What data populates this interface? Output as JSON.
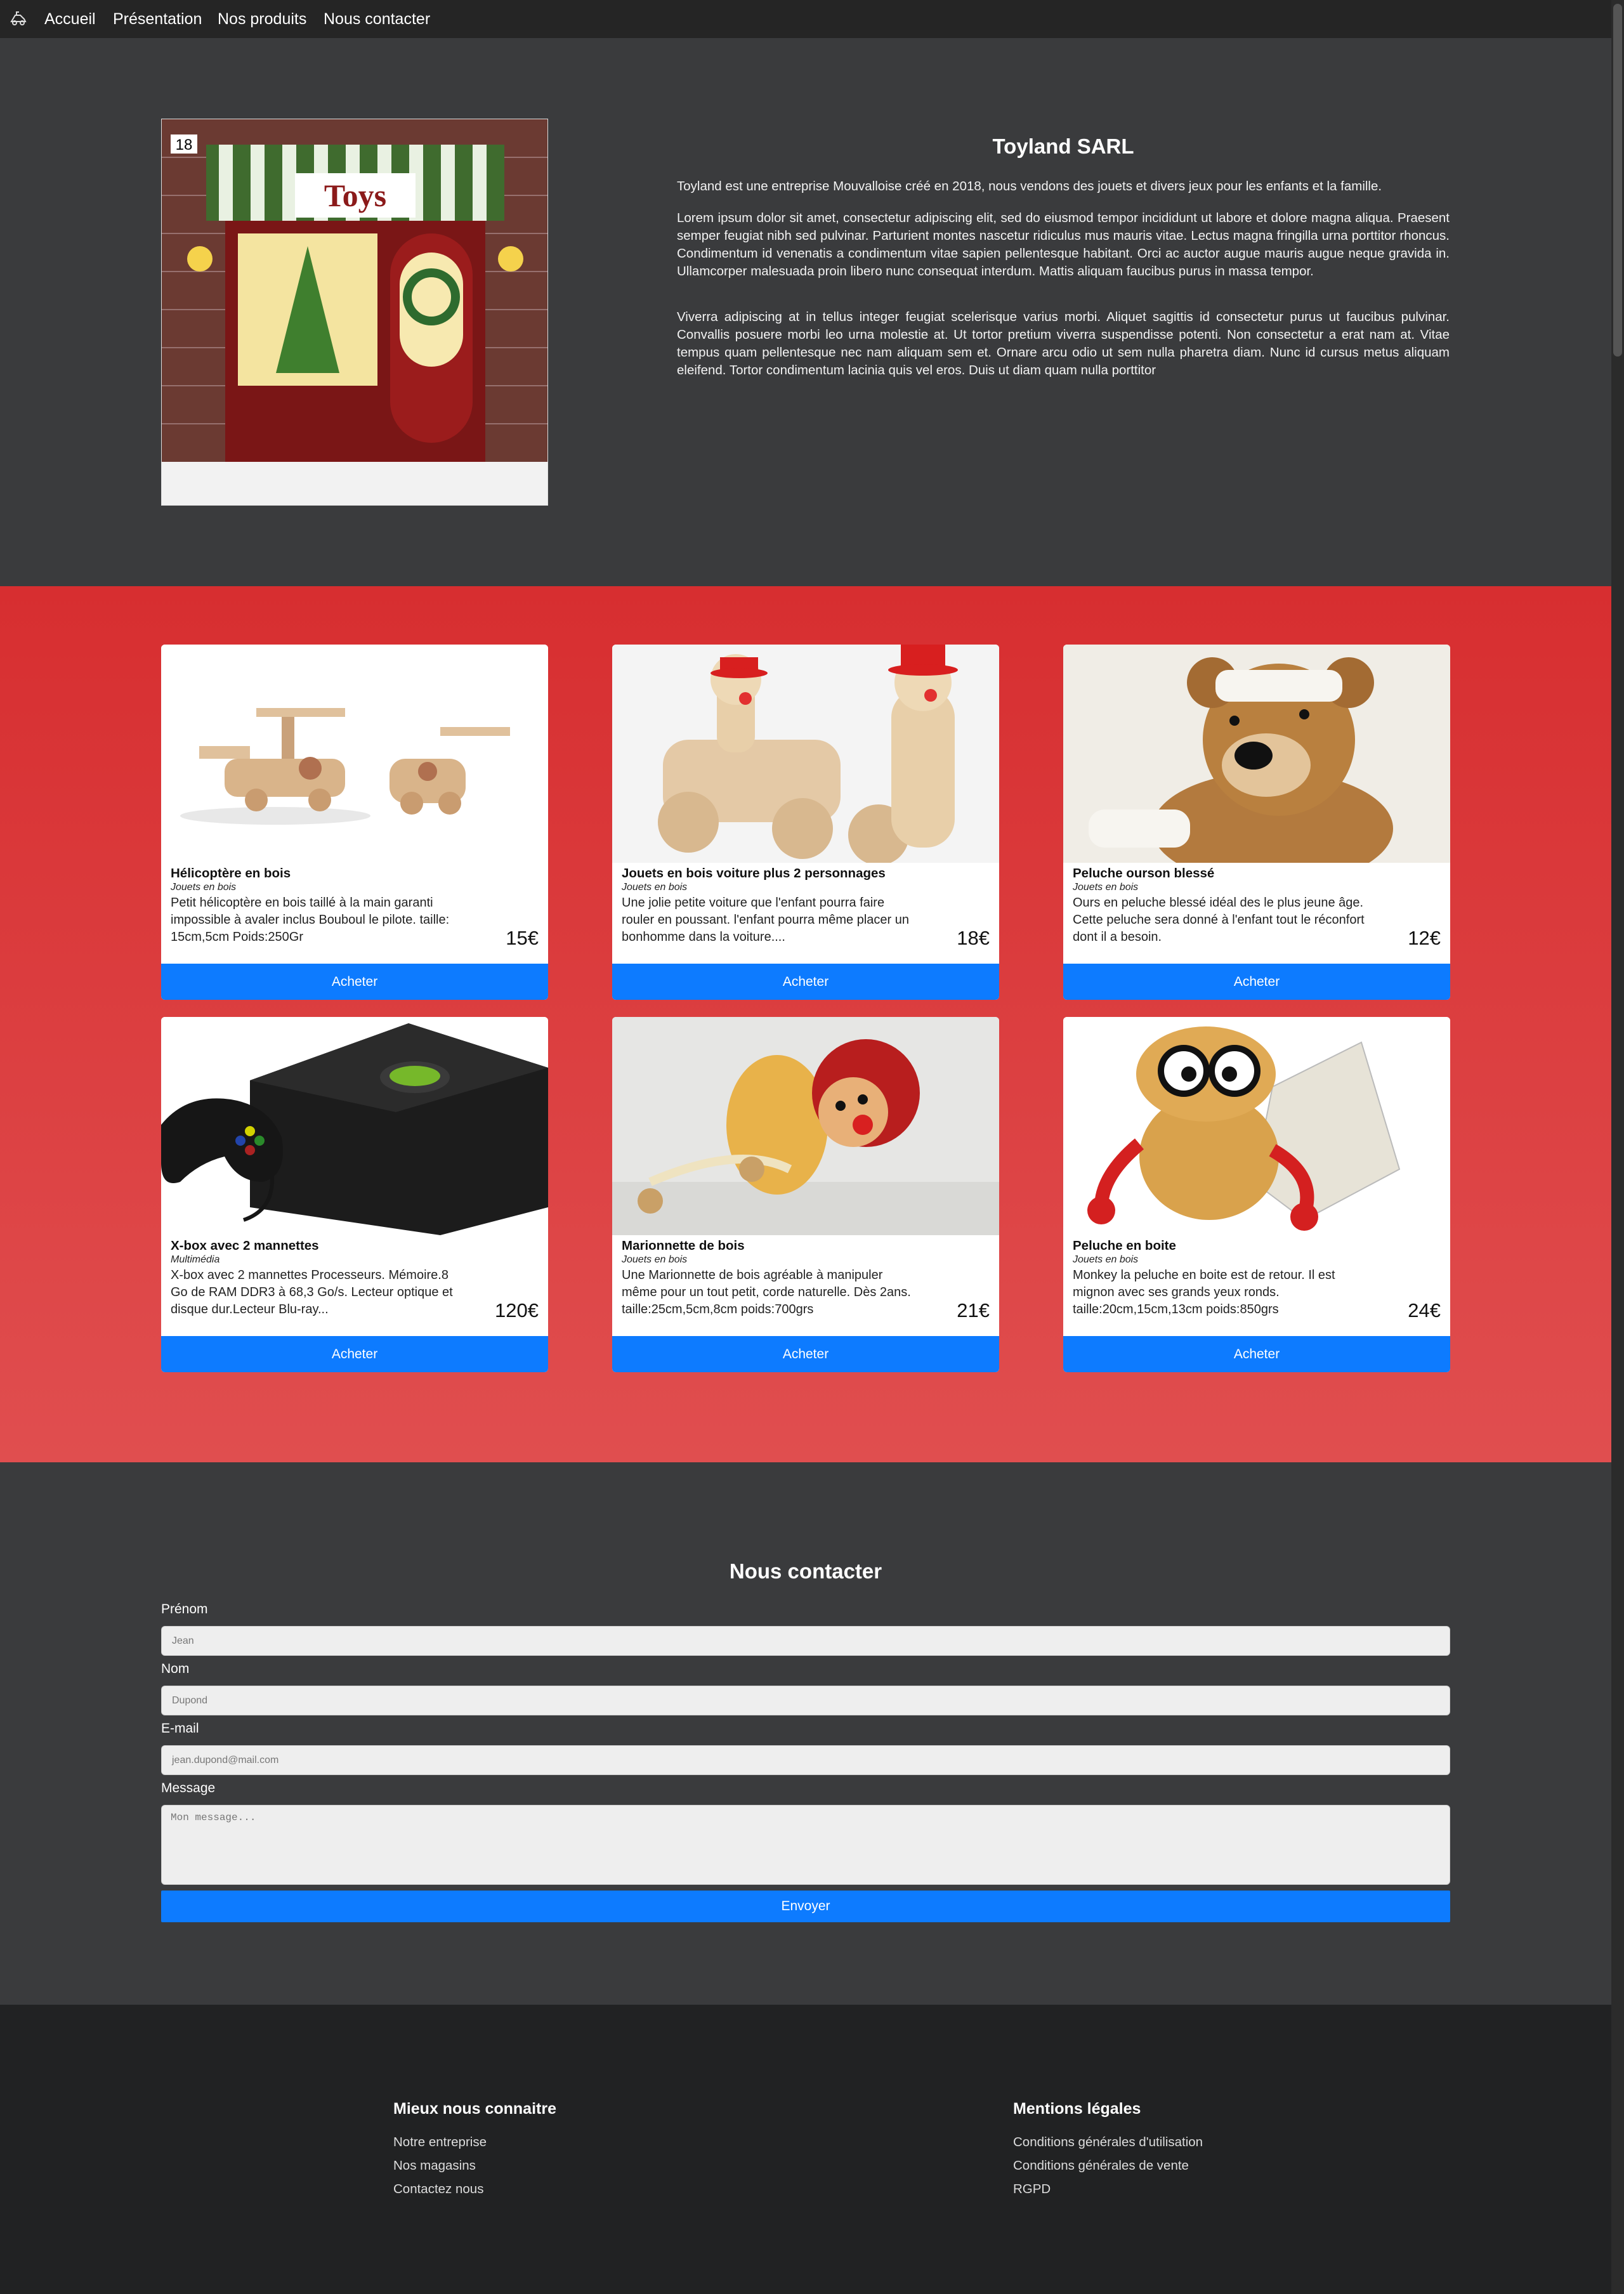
{
  "nav": {
    "logo_icon": "toy-logo-icon",
    "links": [
      "Accueil",
      "Présentation",
      "Nos produits",
      "Nous contacter"
    ]
  },
  "hero": {
    "image_icon": "toy-shop-illustration",
    "image_badge": "18",
    "image_sign": "Toys",
    "title": "Toyland SARL",
    "paragraphs": [
      "Toyland est une entreprise Mouvalloise créé en 2018, nous vendons des jouets et divers jeux pour les enfants et la famille.",
      "Lorem ipsum dolor sit amet, consectetur adipiscing elit, sed do eiusmod tempor incididunt ut labore et dolore magna aliqua. Praesent semper feugiat nibh sed pulvinar. Parturient montes nascetur ridiculus mus mauris vitae. Lectus magna fringilla urna porttitor rhoncus. Condimentum id venenatis a condimentum vitae sapien pellentesque habitant. Orci ac auctor augue mauris augue neque gravida in. Ullamcorper malesuada proin libero nunc consequat interdum. Mattis aliquam faucibus purus in massa tempor.",
      "Viverra adipiscing at in tellus integer feugiat scelerisque varius morbi. Aliquet sagittis id consectetur purus ut faucibus pulvinar. Convallis posuere morbi leo urna molestie at. Ut tortor pretium viverra suspendisse potenti. Non consectetur a erat nam at. Vitae tempus quam pellentesque nec nam aliquam sem et. Ornare arcu odio ut sem nulla pharetra diam. Nunc id cursus metus aliquam eleifend. Tortor condimentum lacinia quis vel eros. Duis ut diam quam nulla porttitor"
    ]
  },
  "products": [
    {
      "name": "Hélicoptère en bois",
      "category": "Jouets en bois",
      "desc": "Petit hélicoptère en bois taillé à la main garanti impossible à avaler inclus Bouboul le pilote. taille: 15cm,5cm Poids:250Gr",
      "price": "15€",
      "buy": "Acheter",
      "image": "wooden-helicopters-photo"
    },
    {
      "name": "Jouets en bois voiture plus 2 personnages",
      "category": "Jouets en bois",
      "desc": "Une jolie petite voiture que l'enfant pourra faire rouler en poussant. l'enfant pourra même placer un bonhomme dans la voiture....",
      "price": "18€",
      "buy": "Acheter",
      "image": "wooden-car-figures-photo"
    },
    {
      "name": "Peluche ourson blessé",
      "category": "Jouets en bois",
      "desc": "Ours en peluche blessé idéal des le plus jeune âge. Cette peluche sera donné à l'enfant tout le réconfort dont il a besoin.",
      "price": "12€",
      "buy": "Acheter",
      "image": "injured-teddy-bear-photo"
    },
    {
      "name": "X-box avec 2 mannettes",
      "category": "Multimédia",
      "desc": "X-box avec 2 mannettes Processeurs. Mémoire.8 Go de RAM DDR3 à 68,3 Go/s. Lecteur optique et disque dur.Lecteur Blu-ray...",
      "price": "120€",
      "buy": "Acheter",
      "image": "xbox-console-photo"
    },
    {
      "name": "Marionnette de bois",
      "category": "Jouets en bois",
      "desc": "Une Marionnette de bois agréable à manipuler même pour un tout petit, corde naturelle. Dès 2ans. taille:25cm,5cm,8cm poids:700grs",
      "price": "21€",
      "buy": "Acheter",
      "image": "wooden-puppet-photo"
    },
    {
      "name": "Peluche en boite",
      "category": "Jouets en bois",
      "desc": "Monkey la peluche en boite est de retour. Il est mignon avec ses grands yeux ronds. taille:20cm,15cm,13cm poids:850grs",
      "price": "24€",
      "buy": "Acheter",
      "image": "monkey-plush-box-photo"
    }
  ],
  "contact": {
    "title": "Nous contacter",
    "fields": [
      {
        "label": "Prénom",
        "placeholder": "Jean"
      },
      {
        "label": "Nom",
        "placeholder": "Dupond"
      },
      {
        "label": "E-mail",
        "placeholder": "jean.dupond@mail.com"
      }
    ],
    "message_label": "Message",
    "message_placeholder": "Mon message...",
    "submit": "Envoyer"
  },
  "footer": {
    "col1": {
      "title": "Mieux nous connaitre",
      "links": [
        "Notre entreprise",
        "Nos magasins",
        "Contactez nous"
      ]
    },
    "col2": {
      "title": "Mentions légales",
      "links": [
        "Conditions générales d'utilisation",
        "Conditions générales de vente",
        "RGPD"
      ]
    }
  },
  "colors": {
    "nav_bg": "#252525",
    "page_bg": "#3a3b3d",
    "products_bg_top": "#d72e30",
    "products_bg_bottom": "#e04e4f",
    "button_blue": "#0d7bff",
    "footer_bg": "#212223"
  }
}
